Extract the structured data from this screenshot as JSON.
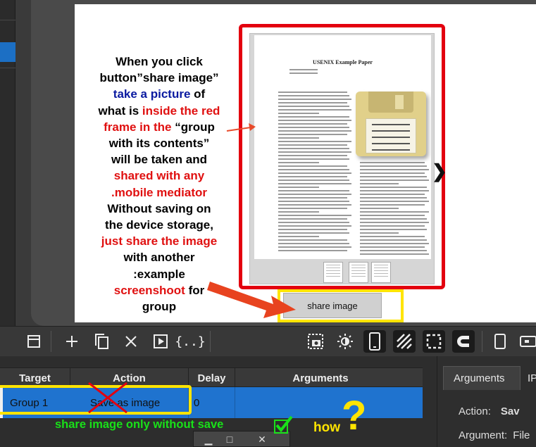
{
  "annotation": {
    "lines": [
      {
        "text": "When you click",
        "color": "#000000"
      },
      {
        "text": "button”share image”",
        "color": "#000000"
      },
      {
        "text": "take a picture",
        "tail": " of",
        "color": "#0a1aa0"
      },
      {
        "text": "what is ",
        "tail": "inside the red",
        "color": "#000000",
        "tail_color": "#e01010"
      },
      {
        "text": "frame in the",
        "tail": " “group",
        "color": "#e01010"
      },
      {
        "text": "with its contents”",
        "color": "#000000"
      },
      {
        "text": "will be taken and",
        "color": "#000000"
      },
      {
        "text": "shared with any",
        "color": "#e01010"
      },
      {
        "text": ".mobile mediator",
        "color": "#e01010"
      },
      {
        "text": "Without saving on",
        "color": "#000000"
      },
      {
        "text": "the device storage,",
        "color": "#000000"
      },
      {
        "text": "just share the image",
        "color": "#e01010"
      },
      {
        "text": "with another",
        "color": "#000000"
      },
      {
        "text": ":example",
        "color": "#000000"
      },
      {
        "text": "screenshoot",
        "tail": " for",
        "color": "#e01010"
      },
      {
        "text": "group",
        "color": "#000000"
      }
    ]
  },
  "paper": {
    "title": "USENIX Example Paper"
  },
  "share_button": {
    "label": "share image"
  },
  "toolbar": {
    "icons": [
      "window-icon",
      "plus-icon",
      "copy-icon",
      "close-icon",
      "play-icon",
      "braces-icon",
      "screenshot-icon",
      "brightness-icon",
      "phone-icon",
      "hatch-icon",
      "select-icon",
      "magnet-icon",
      "portrait-icon",
      "landscape-icon"
    ],
    "active": [
      "phone-icon",
      "hatch-icon",
      "select-icon",
      "magnet-icon"
    ]
  },
  "actions_grid": {
    "headers": [
      "Target",
      "Action",
      "Delay",
      "Arguments"
    ],
    "rows": [
      {
        "target": "Group 1",
        "action": "Save as image",
        "delay": "0",
        "arguments": ""
      }
    ]
  },
  "subwindow": {
    "buttons": [
      "▁",
      "□",
      "✕"
    ]
  },
  "notes": {
    "green": "share image only without save",
    "how": "how",
    "question": "?"
  },
  "right_panel": {
    "tabs": [
      "Arguments",
      "IP"
    ],
    "action_label": "Action:",
    "action_value": "Sav",
    "argument_label": "Argument:",
    "argument_value": "File"
  },
  "colors": {
    "red_frame": "#e3000f",
    "highlight": "#ffe400",
    "selection": "#1f73cf",
    "green_note": "#19e019"
  }
}
